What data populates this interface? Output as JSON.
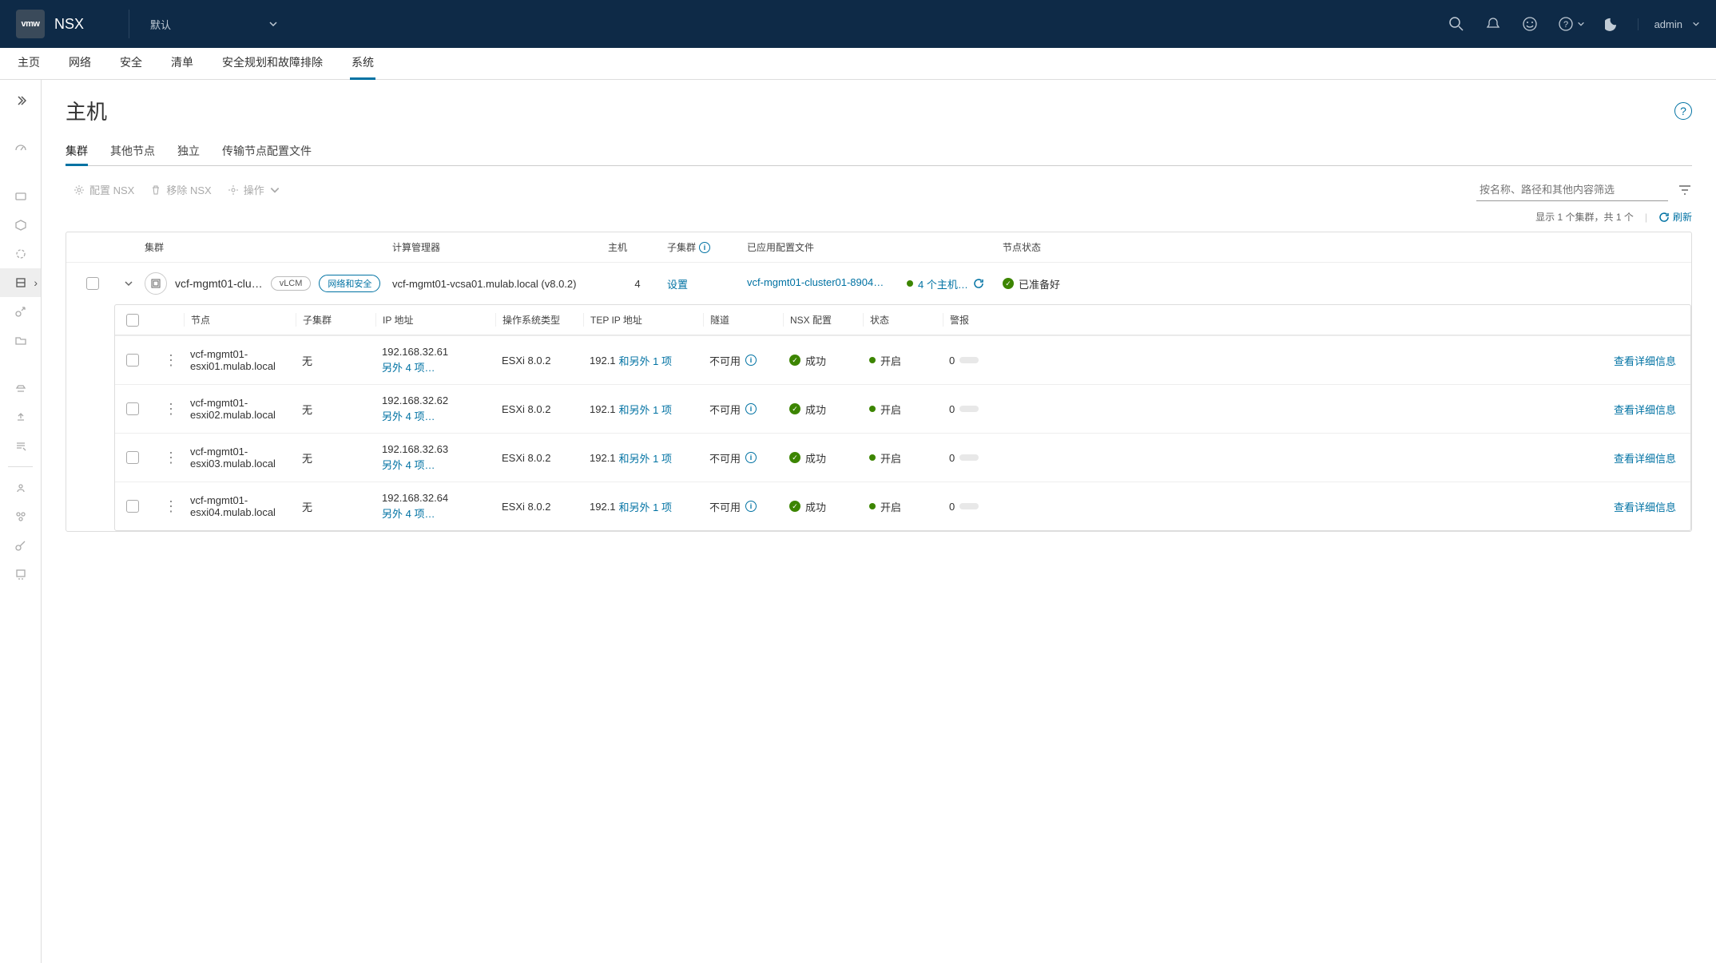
{
  "header": {
    "logo_text": "vmw",
    "product": "NSX",
    "domain": "默认",
    "user": "admin"
  },
  "main_nav": {
    "items": [
      "主页",
      "网络",
      "安全",
      "清单",
      "安全规划和故障排除",
      "系统"
    ],
    "active_index": 5
  },
  "page": {
    "title": "主机",
    "sub_tabs": [
      "集群",
      "其他节点",
      "独立",
      "传输节点配置文件"
    ],
    "active_sub_tab": 0
  },
  "toolbar": {
    "configure_nsx": "配置 NSX",
    "remove_nsx": "移除 NSX",
    "actions": "操作",
    "filter_placeholder": "按名称、路径和其他内容筛选"
  },
  "count": {
    "text": "显示 1 个集群，共 1 个",
    "refresh": "刷新"
  },
  "outer_columns": {
    "cluster": "集群",
    "compute_manager": "计算管理器",
    "hosts": "主机",
    "sub_cluster": "子集群",
    "applied_profile": "已应用配置文件",
    "node_status": "节点状态"
  },
  "cluster_row": {
    "name": "vcf-mgmt01-clu…",
    "pill_vlcm": "vLCM",
    "pill_mode": "网络和安全",
    "compute_manager": "vcf-mgmt01-vcsa01.mulab.local (v8.0.2)",
    "host_count": "4",
    "sub_cluster_link": "设置",
    "profile_link": "vcf-mgmt01-cluster01-8904…",
    "host_status": "4 个主机…",
    "ready_status": "已准备好"
  },
  "inner_columns": {
    "node": "节点",
    "sub_cluster": "子集群",
    "ip": "IP 地址",
    "os_type": "操作系统类型",
    "tep_ip": "TEP IP 地址",
    "tunnel": "隧道",
    "nsx_config": "NSX 配置",
    "state": "状态",
    "alarms": "警报"
  },
  "nodes": [
    {
      "name": "vcf-mgmt01-esxi01.mulab.local",
      "sub_cluster": "无",
      "ip": "192.168.32.61",
      "ip_more": "另外 4 项…",
      "os": "ESXi 8.0.2",
      "tep_prefix": "192.1",
      "tep_link": "和另外 1 项",
      "tunnel": "不可用",
      "nsx_config": "成功",
      "state": "开启",
      "alarms": "0",
      "details": "查看详细信息"
    },
    {
      "name": "vcf-mgmt01-esxi02.mulab.local",
      "sub_cluster": "无",
      "ip": "192.168.32.62",
      "ip_more": "另外 4 项…",
      "os": "ESXi 8.0.2",
      "tep_prefix": "192.1",
      "tep_link": "和另外 1 项",
      "tunnel": "不可用",
      "nsx_config": "成功",
      "state": "开启",
      "alarms": "0",
      "details": "查看详细信息"
    },
    {
      "name": "vcf-mgmt01-esxi03.mulab.local",
      "sub_cluster": "无",
      "ip": "192.168.32.63",
      "ip_more": "另外 4 项…",
      "os": "ESXi 8.0.2",
      "tep_prefix": "192.1",
      "tep_link": "和另外 1 项",
      "tunnel": "不可用",
      "nsx_config": "成功",
      "state": "开启",
      "alarms": "0",
      "details": "查看详细信息"
    },
    {
      "name": "vcf-mgmt01-esxi04.mulab.local",
      "sub_cluster": "无",
      "ip": "192.168.32.64",
      "ip_more": "另外 4 项…",
      "os": "ESXi 8.0.2",
      "tep_prefix": "192.1",
      "tep_link": "和另外 1 项",
      "tunnel": "不可用",
      "nsx_config": "成功",
      "state": "开启",
      "alarms": "0",
      "details": "查看详细信息"
    }
  ]
}
